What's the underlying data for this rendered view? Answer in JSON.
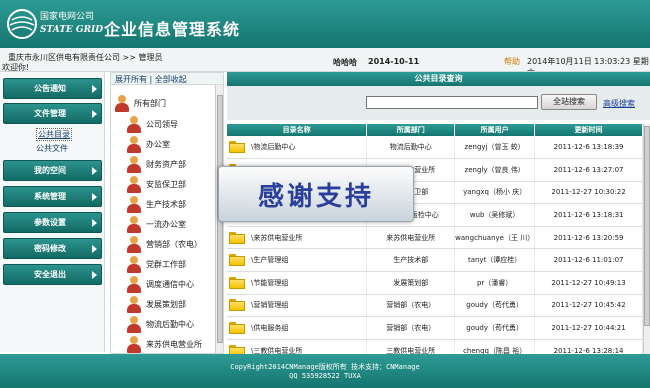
{
  "header": {
    "logo_cn": "国家电网公司",
    "logo_en": "STATE GRID",
    "title": "企业信息管理系统"
  },
  "infobar": {
    "breadcrumb": "重庆市永川区供电有限责任公司 >> 管理员",
    "welcome": "欢迎你!",
    "user_name": "哈哈哈",
    "date": "2014-10-11",
    "help": "帮助",
    "datetime": "2014年10月11日 13:03:23 星期六"
  },
  "nav": {
    "items": [
      {
        "label": "公告通知"
      },
      {
        "label": "文件管理"
      },
      {
        "label": "我的空间"
      },
      {
        "label": "系统管理"
      },
      {
        "label": "参数设置"
      },
      {
        "label": "密码修改"
      },
      {
        "label": "安全退出"
      }
    ],
    "sub_items": [
      "公共目录",
      "公共文件"
    ]
  },
  "tree": {
    "expand_all": "展开所有",
    "separator": "|",
    "collapse_all": "全部收起",
    "root": "所有部门",
    "departments": [
      "公司领导",
      "办公室",
      "财务资产部",
      "安监保卫部",
      "生产技术部",
      "一流办公室",
      "营销部（农电）",
      "党群工作部",
      "调度通信中心",
      "发展策划部",
      "物流后勤中心",
      "来苏供电营业所"
    ]
  },
  "main": {
    "title": "公共目录查询",
    "search_button": "全站搜索",
    "advanced_search": "高级搜索",
    "columns": [
      "目录名称",
      "所属部门",
      "所属用户",
      "更新时间"
    ],
    "rows": [
      {
        "name": "\\物流后勤中心",
        "dept": "物流后勤中心",
        "user": "zengyj（曾玉 蛟）",
        "time": "2011-12-6 13:18:39"
      },
      {
        "name": "\\五间供电营业所",
        "dept": "五间供电营业所",
        "user": "zengly（曾良 伟）",
        "time": "2011-12-6 13:27:07"
      },
      {
        "name": "\\安监保卫部",
        "dept": "安监保卫部",
        "user": "yangxq（杨小 庆）",
        "time": "2011-12-27 10:30:22"
      },
      {
        "name": "\\物资供应中心",
        "dept": "物资供电运检中心",
        "user": "wub（吴修斌）",
        "time": "2011-12-6 13:18:31"
      },
      {
        "name": "\\来苏供电营业所",
        "dept": "来苏供电营业所",
        "user": "wangchuanye（王 川）",
        "time": "2011-12-6 13:20:59"
      },
      {
        "name": "\\生产管理组",
        "dept": "生产技术部",
        "user": "tanyt（谭应桂）",
        "time": "2011-12-6 11:01:07"
      },
      {
        "name": "\\节能管理组",
        "dept": "发展策划部",
        "user": "pr（潘睿）",
        "time": "2011-12-27 10:49:13"
      },
      {
        "name": "\\营销管理组",
        "dept": "营销部（农电）",
        "user": "goudy（苟代勇）",
        "time": "2011-12-27 10:45:42"
      },
      {
        "name": "\\供电服务组",
        "dept": "营销部（农电）",
        "user": "goudy（苟代勇）",
        "time": "2011-12-27 10:44:21"
      },
      {
        "name": "\\三教供电营业所",
        "dept": "三教供电营业所",
        "user": "chengq（陈昌 裕）",
        "time": "2011-12-6 13:28:14"
      }
    ]
  },
  "watermark": "感谢支持",
  "footer": {
    "line1": "CopyRight2014CNManage版权所有 技术支持：CNManage",
    "line2": "QQ 535928522 TUXA"
  },
  "colors": {
    "teal_dark": "#15756f",
    "teal_light": "#2e9b96",
    "folder_yellow": "#f2c200",
    "help_orange": "#d27a00"
  }
}
